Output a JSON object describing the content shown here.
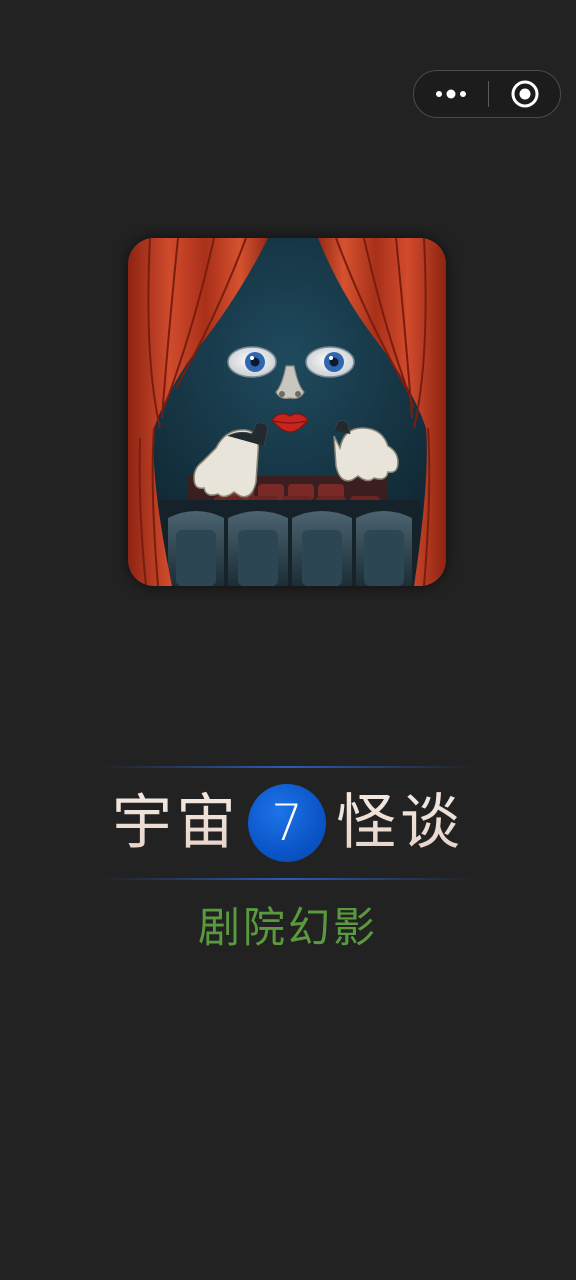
{
  "capsule": {
    "more_icon": "more-dots-icon",
    "close_icon": "target-close-icon"
  },
  "app_icon": {
    "icon": "theater-curtain-face-illustration"
  },
  "title": {
    "part1": "宇宙",
    "number": "7",
    "part2": "怪谈"
  },
  "subtitle": "剧院幻影",
  "colors": {
    "background": "#222222",
    "title_text": "#efe2d8",
    "number_badge": "#0b55c8",
    "subtitle_text": "#5a9a3e",
    "divider_line": "#2a5bb8"
  }
}
